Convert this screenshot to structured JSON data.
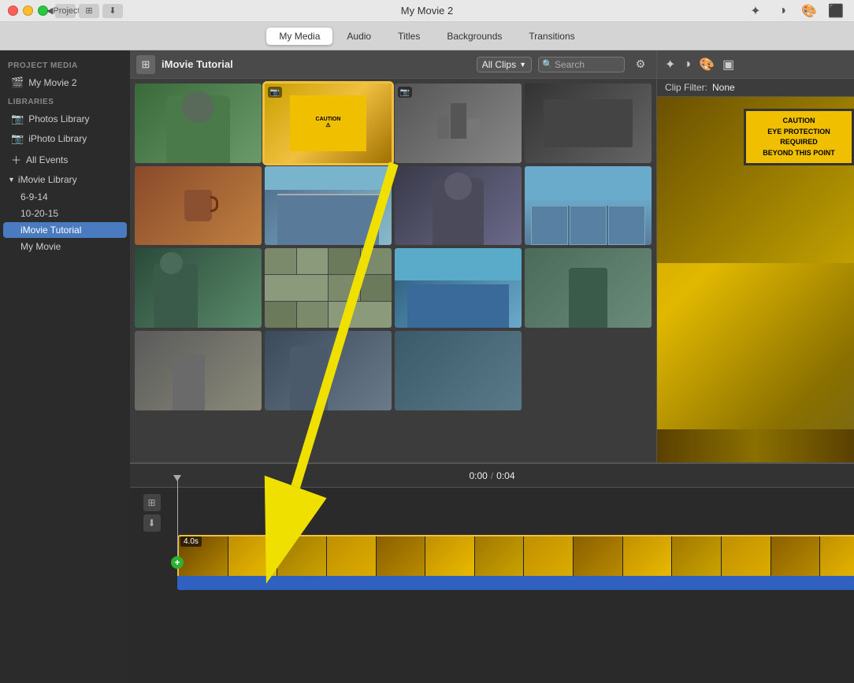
{
  "titlebar": {
    "title": "My Movie 2",
    "back_label": "Projects",
    "nav_back": "◀",
    "nav_fwd": "▶",
    "btn_close": "●",
    "btn_min": "●",
    "btn_max": "●"
  },
  "toolbar": {
    "tabs": [
      {
        "id": "my-media",
        "label": "My Media",
        "active": true
      },
      {
        "id": "audio",
        "label": "Audio",
        "active": false
      },
      {
        "id": "titles",
        "label": "Titles",
        "active": false
      },
      {
        "id": "backgrounds",
        "label": "Backgrounds",
        "active": false
      },
      {
        "id": "transitions",
        "label": "Transitions",
        "active": false
      }
    ],
    "right_icons": [
      "✦",
      "◑",
      "🎨",
      "⬛"
    ]
  },
  "sidebar": {
    "project_media_header": "PROJECT MEDIA",
    "project_item": "My Movie 2",
    "libraries_header": "LIBRARIES",
    "library_items": [
      {
        "label": "Photos Library",
        "icon": "📷"
      },
      {
        "label": "iPhoto Library",
        "icon": "📷"
      },
      {
        "label": "All Events",
        "icon": "＋"
      }
    ],
    "imovie_library": {
      "label": "iMovie Library",
      "children": [
        {
          "label": "6-9-14"
        },
        {
          "label": "10-20-15"
        },
        {
          "label": "iMovie Tutorial",
          "active": true
        },
        {
          "label": "My Movie"
        }
      ]
    }
  },
  "content": {
    "title": "iMovie Tutorial",
    "filter": "All Clips",
    "search_placeholder": "Search",
    "thumbnails": [
      {
        "id": 1,
        "type": "green",
        "has_camera": false
      },
      {
        "id": 2,
        "type": "caution",
        "has_camera": true,
        "selected": true
      },
      {
        "id": 3,
        "type": "workshop",
        "has_camera": true
      },
      {
        "id": 4,
        "type": "dark-tools",
        "has_camera": false
      },
      {
        "id": 5,
        "type": "mug",
        "has_camera": false
      },
      {
        "id": 6,
        "type": "building",
        "has_camera": false
      },
      {
        "id": 7,
        "type": "woman",
        "has_camera": false
      },
      {
        "id": 8,
        "type": "building2",
        "has_camera": false
      },
      {
        "id": 9,
        "type": "person-wall",
        "has_camera": false
      },
      {
        "id": 10,
        "type": "wall-stones",
        "has_camera": false
      },
      {
        "id": 11,
        "type": "blue-building",
        "has_camera": false
      },
      {
        "id": 12,
        "type": "outdoor-person",
        "has_camera": false
      },
      {
        "id": 13,
        "type": "statue",
        "has_camera": false
      },
      {
        "id": 14,
        "type": "worker",
        "has_camera": false
      },
      {
        "id": 15,
        "type": "worker2",
        "has_camera": false
      }
    ]
  },
  "preview": {
    "clip_filter_label": "Clip Filter:",
    "clip_filter_value": "None",
    "caution_lines": [
      "CAUTION",
      "EYE PROTECTION",
      "REQUIRED",
      "BEYOND THIS POINT"
    ]
  },
  "timeline": {
    "time_current": "0:00",
    "time_total": "0:04",
    "separator": "/",
    "clip_duration": "4.0s",
    "frame_count": 14
  },
  "arrow": {
    "color": "#f0e000"
  }
}
